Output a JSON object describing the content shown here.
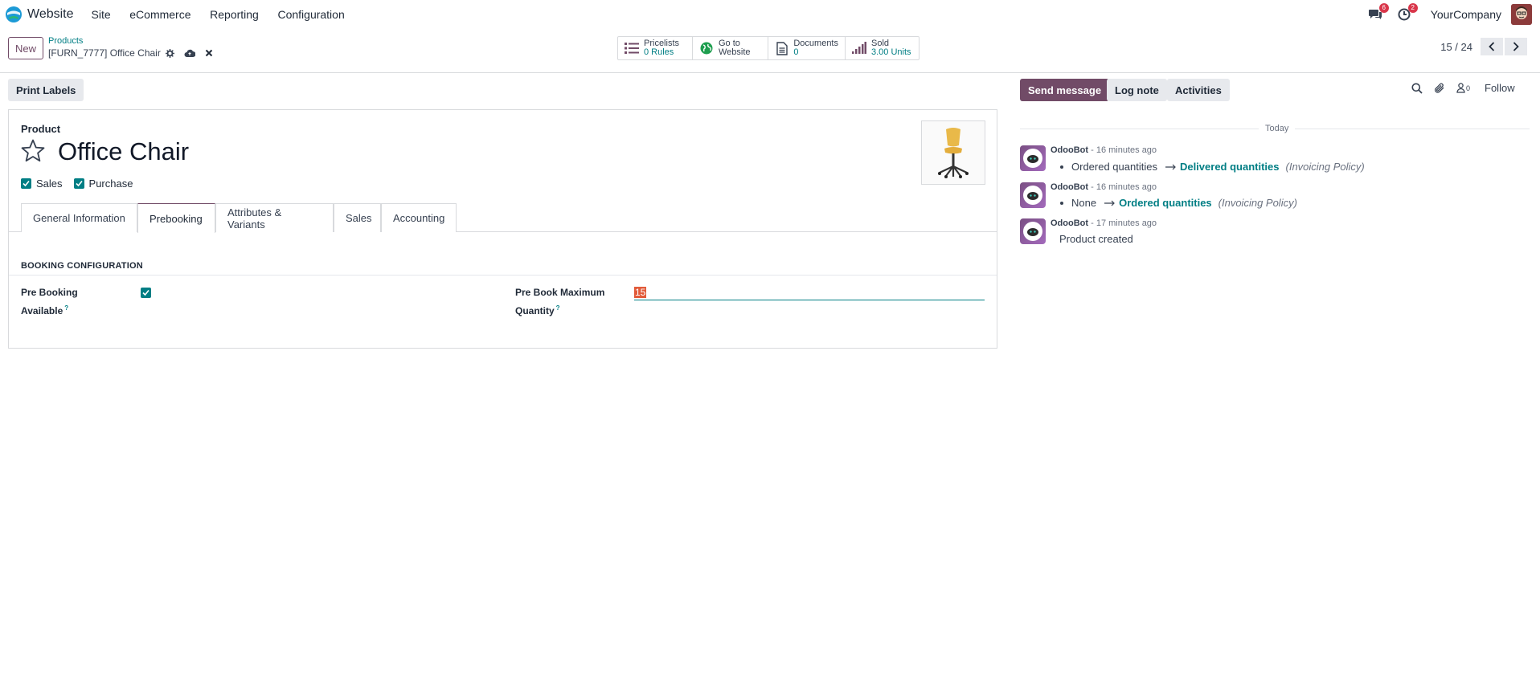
{
  "navbar": {
    "app_name": "Website",
    "menu": [
      "Site",
      "eCommerce",
      "Reporting",
      "Configuration"
    ],
    "chat_badge": "6",
    "activity_badge": "2",
    "company": "YourCompany"
  },
  "control_panel": {
    "new_label": "New",
    "breadcrumb_parent": "Products",
    "breadcrumb_current": "[FURN_7777] Office Chair",
    "stats": [
      {
        "line1": "Pricelists",
        "line2": "0 Rules",
        "icon": "list-icon"
      },
      {
        "line1": "Go to",
        "line2": "Website",
        "icon": "globe-icon"
      },
      {
        "line1": "Documents",
        "line2": "0",
        "icon": "document-icon"
      },
      {
        "line1": "Sold",
        "line2": "3.00 Units",
        "icon": "signal-icon"
      }
    ],
    "pager": "15 / 24"
  },
  "statusbar": {
    "print_labels": "Print Labels"
  },
  "form": {
    "product_label": "Product",
    "product_name": "Office Chair",
    "sales_label": "Sales",
    "purchase_label": "Purchase",
    "sales_checked": true,
    "purchase_checked": true,
    "tabs": [
      "General Information",
      "Prebooking",
      "Attributes & Variants",
      "Sales",
      "Accounting"
    ],
    "active_tab": "Prebooking",
    "section_title": "BOOKING CONFIGURATION",
    "pre_booking_label_1": "Pre Booking",
    "pre_booking_label_2": "Available",
    "pre_booking_checked": true,
    "max_qty_label_1": "Pre Book Maximum",
    "max_qty_label_2": "Quantity",
    "max_qty_value": "15",
    "help_mark": "?"
  },
  "chatter": {
    "send_message": "Send message",
    "log_note": "Log note",
    "activities": "Activities",
    "followers_count": "0",
    "follow": "Follow",
    "day": "Today",
    "messages": [
      {
        "author": "OdooBot",
        "time": "- 16 minutes ago",
        "old": "Ordered quantities",
        "new": "Delivered quantities",
        "field": "(Invoicing Policy)"
      },
      {
        "author": "OdooBot",
        "time": "- 16 minutes ago",
        "old": "None",
        "new": "Ordered quantities",
        "field": "(Invoicing Policy)"
      },
      {
        "author": "OdooBot",
        "time": "- 17 minutes ago",
        "text": "Product created"
      }
    ]
  },
  "colors": {
    "brand": "#714b67",
    "accent": "#017e84",
    "badge": "#d9364a"
  }
}
